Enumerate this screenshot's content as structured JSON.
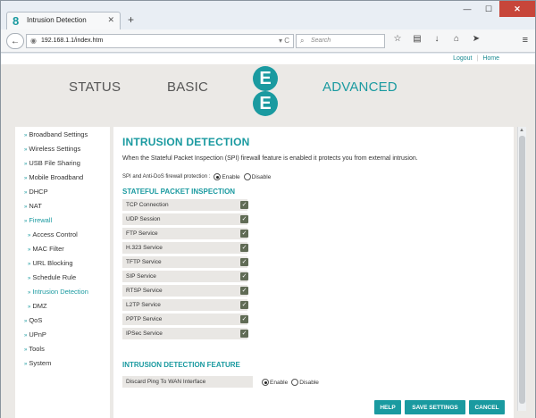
{
  "browser": {
    "tab_title": "Intrusion Detection",
    "tab_favicon": "8",
    "url": "192.168.1.1/index.htm",
    "search_placeholder": "Search"
  },
  "toplinks": {
    "logout": "Logout",
    "home": "Home"
  },
  "menu": {
    "status": "STATUS",
    "basic": "BASIC",
    "advanced": "ADVANCED"
  },
  "logo": {
    "letter_top": "E",
    "letter_bottom": "E"
  },
  "sidebar": {
    "items": [
      "Broadband Settings",
      "Wireless Settings",
      "USB File Sharing",
      "Mobile Broadband",
      "DHCP",
      "NAT",
      "Firewall",
      "Access Control",
      "MAC Filter",
      "URL Blocking",
      "Schedule Rule",
      "Intrusion Detection",
      "DMZ",
      "QoS",
      "UPnP",
      "Tools",
      "System"
    ]
  },
  "content": {
    "title": "INTRUSION DETECTION",
    "description": "When the Stateful Packet Inspection (SPI) firewall feature is enabled it protects you from external intrusion.",
    "spi_label": "SPI and Anti-DoS firewall protection :",
    "enable": "Enable",
    "disable": "Disable",
    "spi_section": "STATEFUL PACKET INSPECTION",
    "packets": [
      "TCP Connection",
      "UDP Session",
      "FTP Service",
      "H.323 Service",
      "TFTP Service",
      "SIP Service",
      "RTSP Service",
      "L2TP Service",
      "PPTP Service",
      "IPSec Service"
    ],
    "feature_section": "INTRUSION DETECTION FEATURE",
    "discard_label": "Discard Ping To WAN Interface"
  },
  "buttons": {
    "help": "HELP",
    "save": "SAVE SETTINGS",
    "cancel": "CANCEL"
  },
  "colors": {
    "accent": "#1a9aa0",
    "header_bg": "#ebe9e6",
    "check": "#606b55"
  }
}
